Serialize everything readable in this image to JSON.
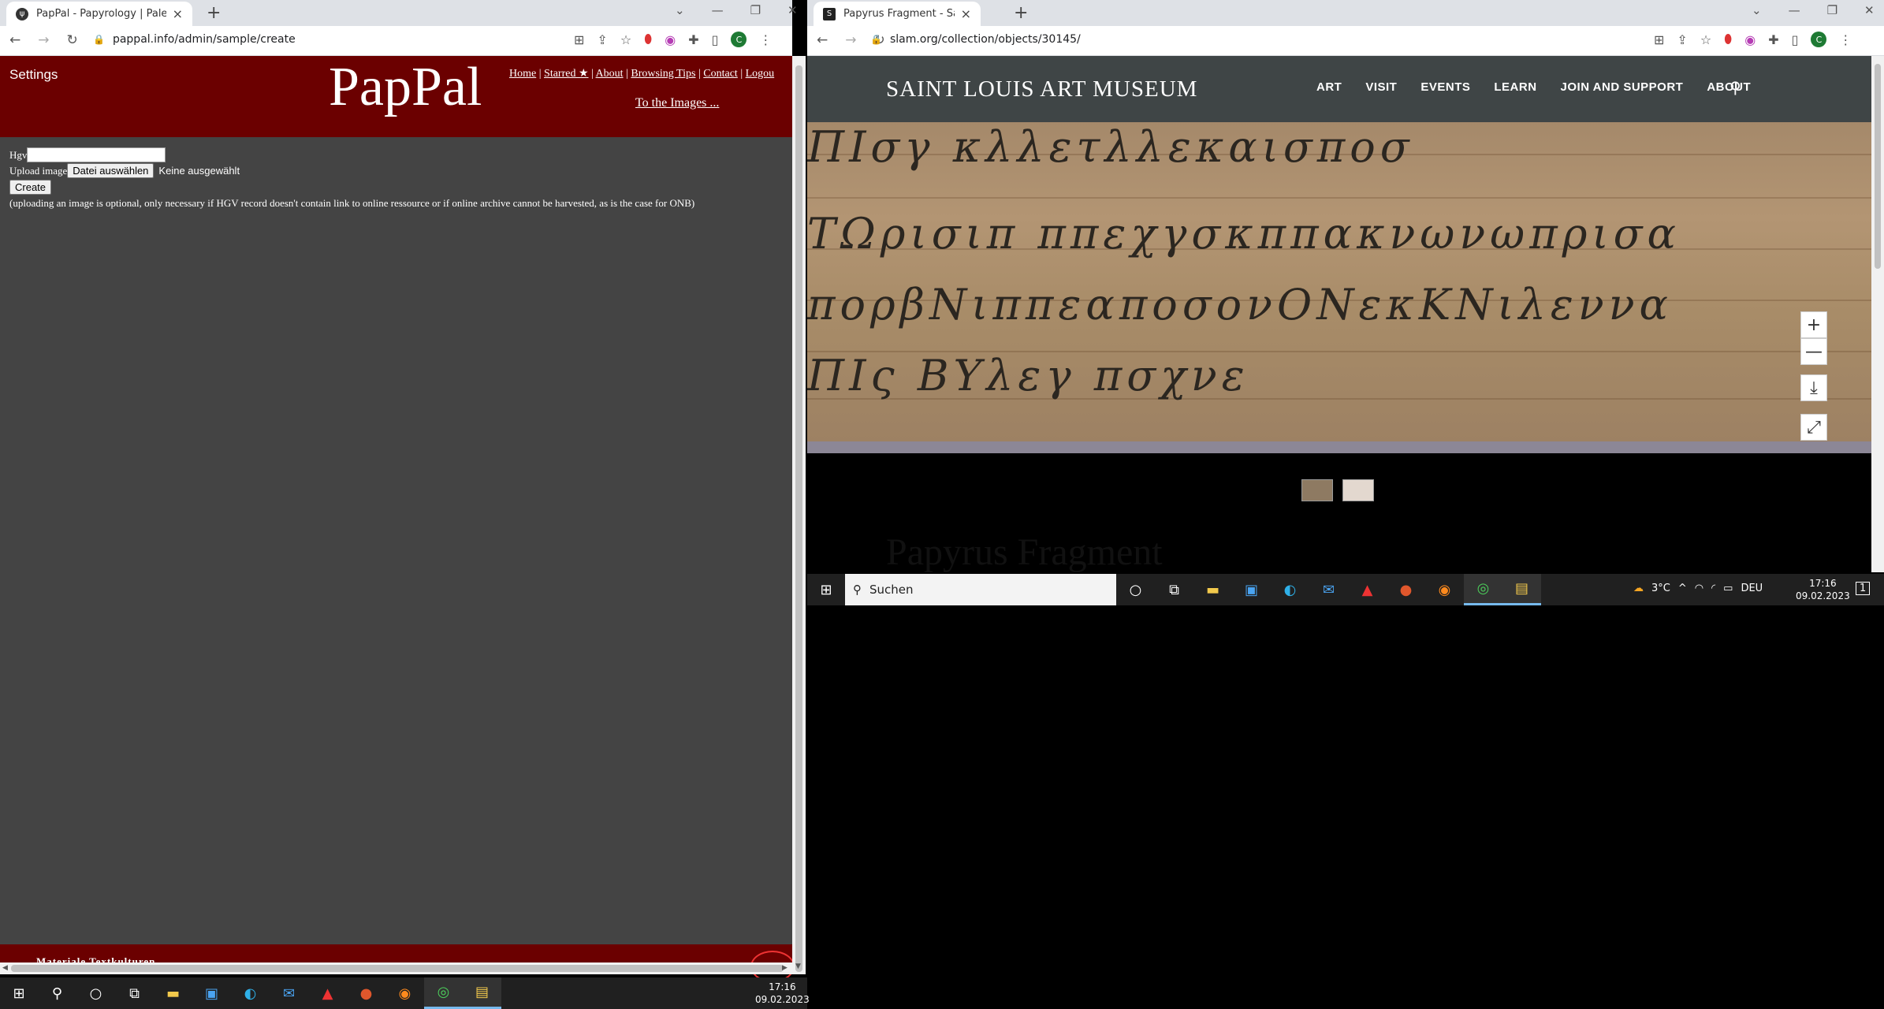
{
  "left_browser": {
    "tab_title": "PapPal - Papyrology | Paleograph",
    "url": "pappal.info/admin/sample/create"
  },
  "pappal": {
    "settings": "Settings",
    "logo": "PapPal",
    "menu": [
      "Home",
      "Starred ★",
      "About",
      "Browsing Tips",
      "Contact",
      "Logou"
    ],
    "to_images": "To the Images ...",
    "hgv_label": "Hgv",
    "upload_label": "Upload image",
    "choose_file": "Datei auswählen",
    "no_file": "Keine ausgewählt",
    "create_button": "Create",
    "note": "(uploading an image is optional, only necessary if HGV record doesn't contain link to online ressource or if online archive cannot be harvested, as is the case for ONB)",
    "footer": "Materiale Textkulturen"
  },
  "right_browser": {
    "tab_title": "Papyrus Fragment - Saint Louis A",
    "url": "slam.org/collection/objects/30145/"
  },
  "slam": {
    "logo": "SAINT LOUIS ART MUSEUM",
    "nav": [
      "ART",
      "VISIT",
      "EVENTS",
      "LEARN",
      "JOIN AND SUPPORT",
      "ABOUT"
    ],
    "title": "Papyrus Fragment",
    "zoom_in": "+",
    "zoom_out": "—"
  },
  "taskbar_left": {
    "time": "17:16",
    "date": "09.02.2023"
  },
  "taskbar_right": {
    "search_placeholder": "Suchen",
    "weather": "3°C",
    "lang": "DEU",
    "time": "17:16",
    "date": "09.02.2023",
    "notifications": "1"
  }
}
